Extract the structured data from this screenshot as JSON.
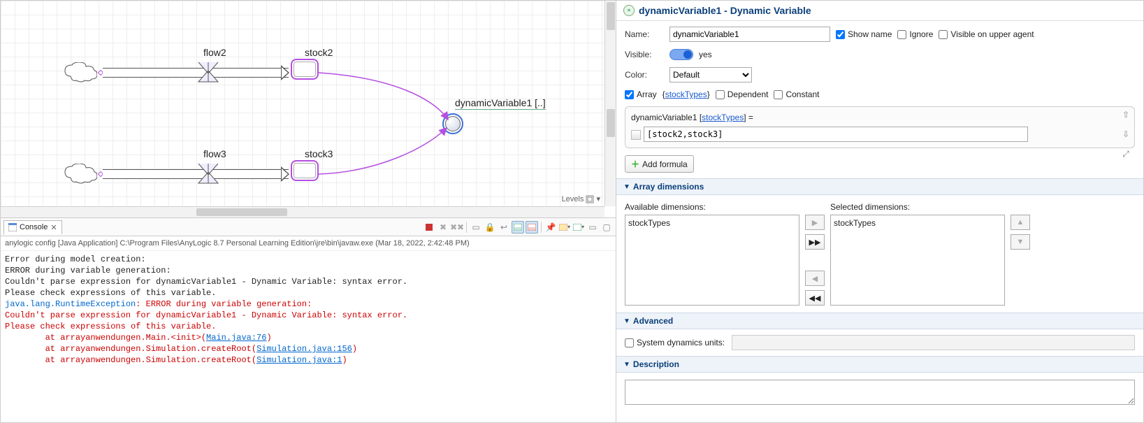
{
  "canvas": {
    "flow2_label": "flow2",
    "flow3_label": "flow3",
    "stock2_label": "stock2",
    "stock3_label": "stock3",
    "dv_label": "dynamicVariable1 [..]",
    "levels_label": "Levels"
  },
  "console": {
    "tab_label": "Console",
    "run_config": "anylogic config [Java Application] C:\\Program Files\\AnyLogic 8.7 Personal Learning Edition\\jre\\bin\\javaw.exe  (Mar 18, 2022, 2:42:48 PM)",
    "l1": "Error during model creation:",
    "l2": "ERROR during variable generation:",
    "l3": "Couldn't parse expression for dynamicVariable1 - Dynamic Variable: syntax error.",
    "l4": "Please check expressions of this variable.",
    "ex_head": "java.lang.RuntimeException",
    "ex_msg": ": ERROR during variable generation:",
    "l6": "Couldn't parse expression for dynamicVariable1 - Dynamic Variable: syntax error.",
    "l7": "Please check expressions of this variable.",
    "t1a": "        at arrayanwendungen.Main.<init>(",
    "t1b": "Main.java:76",
    "t1c": ")",
    "t2a": "        at arrayanwendungen.Simulation.createRoot(",
    "t2b": "Simulation.java:156",
    "t2c": ")",
    "t3a": "        at arrayanwendungen.Simulation.createRoot(",
    "t3b": "Simulation.java:1",
    "t3c": ")"
  },
  "props": {
    "title": "dynamicVariable1 - Dynamic Variable",
    "name_label": "Name:",
    "name_value": "dynamicVariable1",
    "show_name": "Show name",
    "ignore": "Ignore",
    "visible_upper": "Visible on upper agent",
    "visible_label": "Visible:",
    "visible_value": "yes",
    "color_label": "Color:",
    "color_value": "Default",
    "array_label": "Array",
    "array_link": "stockTypes",
    "dependent": "Dependent",
    "constant": "Constant",
    "formula_head_a": "dynamicVariable1 [",
    "formula_head_link": "stockTypes",
    "formula_head_b": "] =",
    "formula_value": "[stock2,stock3]",
    "add_formula": "Add formula",
    "section_dims": "Array dimensions",
    "avail_label": "Available dimensions:",
    "sel_label": "Selected dimensions:",
    "avail_item": "stockTypes",
    "sel_item": "stockTypes",
    "section_adv": "Advanced",
    "sys_units": "System dynamics units:",
    "section_desc": "Description"
  }
}
